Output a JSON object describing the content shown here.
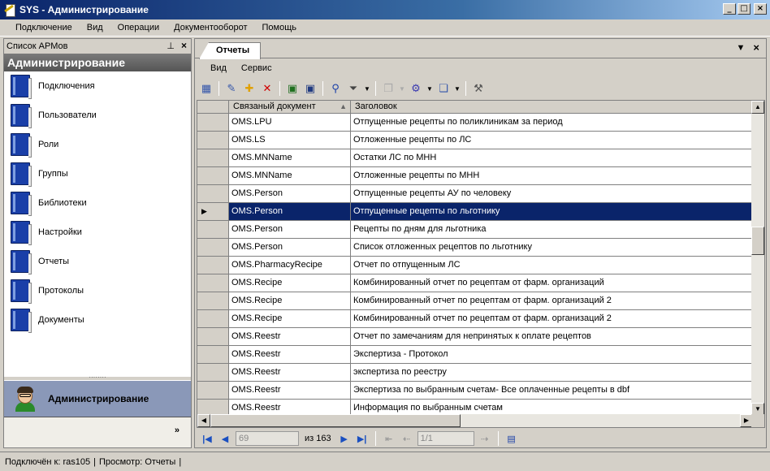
{
  "window": {
    "title": "SYS - Администрирование"
  },
  "menu": [
    "Подключение",
    "Вид",
    "Операции",
    "Документооборот",
    "Помощь"
  ],
  "left_panel": {
    "header": "Список АРМов",
    "title": "Администрирование",
    "items": [
      "Подключения",
      "Пользователи",
      "Роли",
      "Группы",
      "Библиотеки",
      "Настройки",
      "Отчеты",
      "Протоколы",
      "Документы"
    ],
    "active_group": "Администрирование"
  },
  "tab": {
    "label": "Отчеты"
  },
  "submenu": [
    "Вид",
    "Сервис"
  ],
  "grid": {
    "columns": [
      "Связаный документ",
      "Заголовок"
    ],
    "selected_row_index": 5,
    "rows": [
      [
        "OMS.LPU",
        "Отпущенные рецепты по поликлиникам за период"
      ],
      [
        "OMS.LS",
        "Отложенные рецепты по ЛС"
      ],
      [
        "OMS.MNName",
        "Остатки ЛС по МНН"
      ],
      [
        "OMS.MNName",
        "Отложенные рецепты по МНН"
      ],
      [
        "OMS.Person",
        "Отпущенные рецепты АУ по человеку"
      ],
      [
        "OMS.Person",
        "Отпущенные рецепты по льготнику"
      ],
      [
        "OMS.Person",
        "Рецепты по дням для льготника"
      ],
      [
        "OMS.Person",
        "Список отложенных рецептов по льготнику"
      ],
      [
        "OMS.PharmacyRecipe",
        "Отчет по отпущенным ЛС"
      ],
      [
        "OMS.Recipe",
        "Комбинированный отчет по рецептам от фарм. организаций"
      ],
      [
        "OMS.Recipe",
        "Комбинированный отчет по рецептам от фарм. организаций 2"
      ],
      [
        "OMS.Recipe",
        "Комбинированный отчет по рецептам от фарм. организаций 2"
      ],
      [
        "OMS.Reestr",
        "Отчет по замечаниям для непринятых к оплате рецептов"
      ],
      [
        "OMS.Reestr",
        "Экспертиза - Протокол"
      ],
      [
        "OMS.Reestr",
        "экспертиза по реестру"
      ],
      [
        "OMS.Reestr",
        "Экспертиза по выбранным счетам- Все оплаченные  рецепты в dbf"
      ],
      [
        "OMS.Reestr",
        "Информация по выбранным счетам"
      ]
    ]
  },
  "navigator": {
    "record_value": "69",
    "of_label": "из 163",
    "page_value": "1/1"
  },
  "status": {
    "connected": "Подключён к: ras105",
    "view": "Просмотр: Отчеты"
  }
}
